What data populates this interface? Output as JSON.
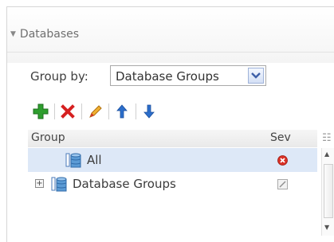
{
  "panel": {
    "title": "Databases",
    "group_by": {
      "label": "Group by:",
      "selected": "Database Groups"
    },
    "toolbar": {
      "add_icon": "add-icon",
      "delete_icon": "delete-icon",
      "edit_icon": "edit-icon",
      "move_up_icon": "move-up-icon",
      "move_down_icon": "move-down-icon"
    },
    "grid": {
      "columns": [
        "Group",
        "Sev"
      ],
      "rows": [
        {
          "label": "All",
          "severity": "critical",
          "selected": true
        },
        {
          "label": "Database Groups",
          "severity": "unknown",
          "expandable": true
        }
      ]
    }
  },
  "colors": {
    "selection": "#dde8f7",
    "critical": "#d93025",
    "add": "#2e9e2e",
    "delete": "#d62020",
    "arrow": "#2c6ecb"
  }
}
